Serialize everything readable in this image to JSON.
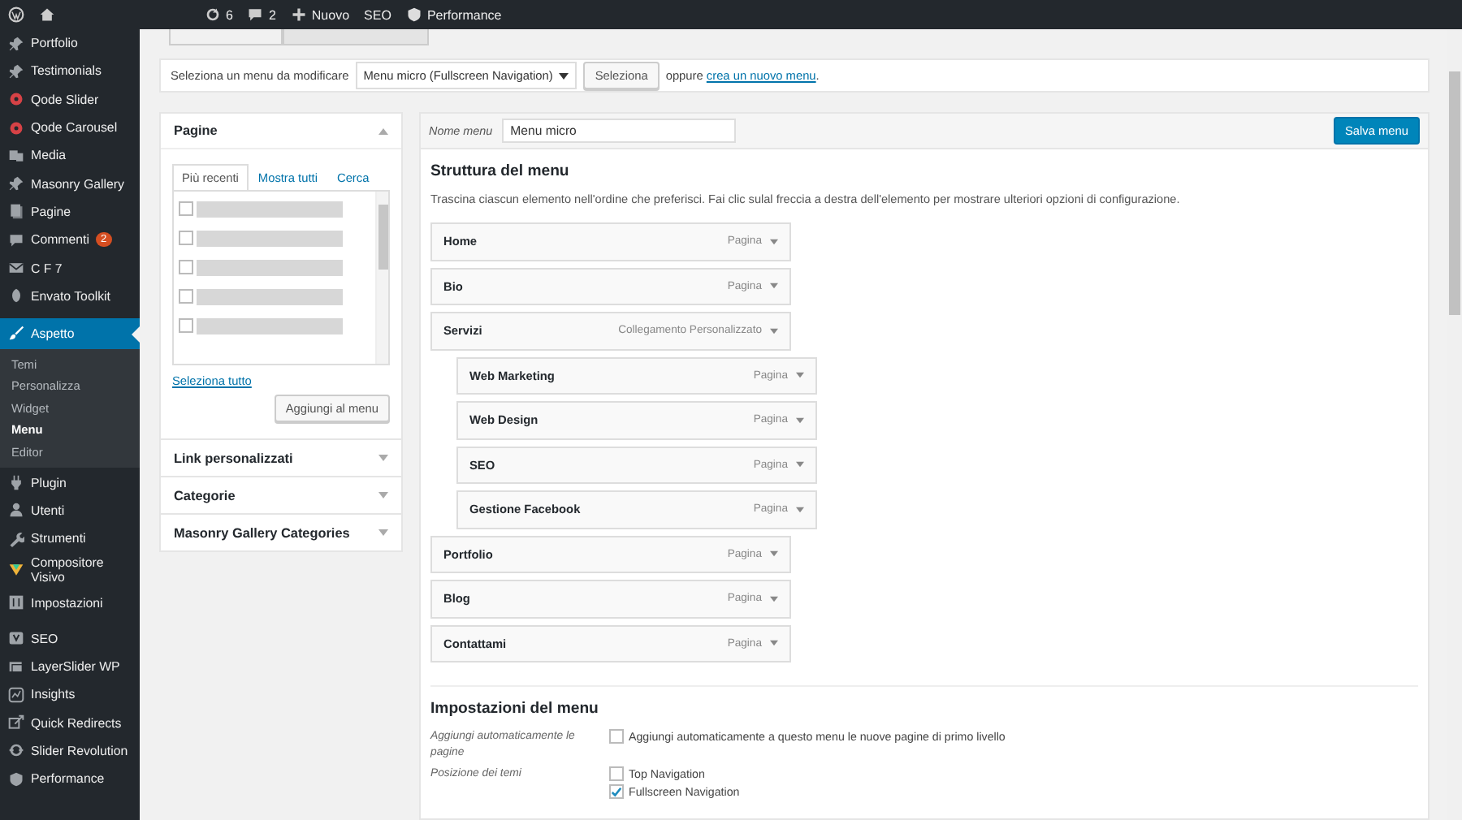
{
  "admin_bar": {
    "items": [
      {
        "kind": "logo"
      },
      {
        "kind": "home"
      },
      {
        "kind": "updates",
        "label": "6"
      },
      {
        "kind": "comments",
        "label": "2"
      },
      {
        "kind": "new",
        "label": "Nuovo"
      },
      {
        "kind": "text",
        "label": "SEO"
      },
      {
        "kind": "performance",
        "label": "Performance"
      }
    ]
  },
  "sidebar": {
    "groups": [
      {
        "items": [
          {
            "label": "Portfolio",
            "kind": "pin",
            "selected": false
          },
          {
            "label": "Testimonials",
            "kind": "pin",
            "selected": false
          },
          {
            "label": "Qode Slider",
            "kind": "dot",
            "selected": false
          },
          {
            "label": "Qode Carousel",
            "kind": "dot",
            "selected": false
          },
          {
            "label": "Media",
            "kind": "media",
            "selected": false
          },
          {
            "label": "Masonry Gallery",
            "kind": "pin",
            "selected": false
          },
          {
            "label": "Pagine",
            "kind": "page",
            "selected": false
          },
          {
            "label": "Commenti",
            "kind": "comment",
            "selected": false,
            "badge": "2"
          },
          {
            "label": "C F 7",
            "kind": "mail",
            "selected": false
          },
          {
            "label": "Envato Toolkit",
            "kind": "leaf",
            "selected": false
          }
        ]
      },
      {
        "items": [
          {
            "label": "Aspetto",
            "kind": "brush",
            "selected": true,
            "children": [
              {
                "label": "Temi",
                "selected": false
              },
              {
                "label": "Personalizza",
                "selected": false
              },
              {
                "label": "Widget",
                "selected": false
              },
              {
                "label": "Menu",
                "selected": true
              },
              {
                "label": "Editor",
                "selected": false
              }
            ]
          },
          {
            "label": "Plugin",
            "kind": "plug",
            "selected": false
          },
          {
            "label": "Utenti",
            "kind": "user",
            "selected": false
          },
          {
            "label": "Strumenti",
            "kind": "wrench",
            "selected": false
          },
          {
            "label": "Compositore Visivo",
            "kind": "vc",
            "selected": false
          },
          {
            "label": "Impostazioni",
            "kind": "settings",
            "selected": false
          }
        ]
      },
      {
        "items": [
          {
            "label": "SEO",
            "kind": "seo",
            "selected": false
          },
          {
            "label": "LayerSlider WP",
            "kind": "layers",
            "selected": false
          },
          {
            "label": "Insights",
            "kind": "insights",
            "selected": false
          },
          {
            "label": "Quick Redirects",
            "kind": "redirect",
            "selected": false
          },
          {
            "label": "Slider Revolution",
            "kind": "refresh",
            "selected": false
          },
          {
            "label": "Performance",
            "kind": "performance",
            "selected": false
          }
        ]
      }
    ]
  },
  "select_bar": {
    "label": "Seleziona un menu da modificare",
    "dropdown_value": "Menu micro (Fullscreen Navigation)",
    "button": "Seleziona",
    "or_text": "oppure",
    "link": "crea un nuovo menu",
    "after_link": "."
  },
  "left_panels": [
    {
      "title": "Pagine",
      "expanded": true,
      "tabs": [
        {
          "label": "Più recenti",
          "selected": true
        },
        {
          "label": "Mostra tutti",
          "selected": false
        },
        {
          "label": "Cerca",
          "selected": false
        }
      ],
      "pages": [
        {
          "checked": false
        },
        {
          "checked": false
        },
        {
          "checked": false
        },
        {
          "checked": false
        },
        {
          "checked": false
        }
      ],
      "select_all": "Seleziona tutto",
      "add_button": "Aggiungi al menu"
    },
    {
      "title": "Link personalizzati",
      "expanded": false
    },
    {
      "title": "Categorie",
      "expanded": false
    },
    {
      "title": "Masonry Gallery Categories",
      "expanded": false
    }
  ],
  "menu_editor": {
    "name_label": "Nome menu",
    "name_value": "Menu micro",
    "save_button": "Salva menu",
    "structure_title": "Struttura del menu",
    "structure_hint": "Trascina ciascun elemento nell'ordine che preferisci. Fai clic sulal freccia a destra dell'elemento per mostrare ulteriori opzioni di configurazione.",
    "items": [
      {
        "title": "Home",
        "type": "Pagina"
      },
      {
        "title": "Bio",
        "type": "Pagina"
      },
      {
        "title": "Servizi",
        "type": "Collegamento Personalizzato",
        "children": [
          {
            "title": "Web Marketing",
            "type": "Pagina"
          },
          {
            "title": "Web Design",
            "type": "Pagina"
          },
          {
            "title": "SEO",
            "type": "Pagina"
          },
          {
            "title": "Gestione Facebook",
            "type": "Pagina"
          }
        ]
      },
      {
        "title": "Portfolio",
        "type": "Pagina"
      },
      {
        "title": "Blog",
        "type": "Pagina"
      },
      {
        "title": "Contattami",
        "type": "Pagina"
      }
    ],
    "settings_title": "Impostazioni del menu",
    "settings": [
      {
        "label": "Aggiungi automaticamente le pagine",
        "options": [
          {
            "label": "Aggiungi automaticamente a questo menu le nuove pagine di primo livello",
            "checked": false
          }
        ]
      },
      {
        "label": "Posizione dei temi",
        "options": [
          {
            "label": "Top Navigation",
            "checked": false
          },
          {
            "label": "Fullscreen Navigation",
            "checked": true
          }
        ]
      }
    ]
  }
}
